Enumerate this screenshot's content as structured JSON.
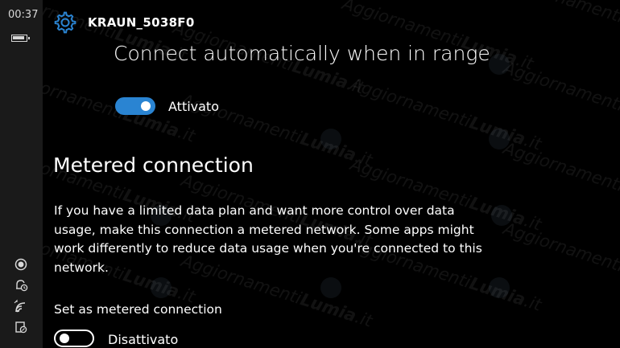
{
  "status_bar": {
    "time": "00:37",
    "icons": [
      "battery-icon",
      "location-icon",
      "quiet-hours-icon",
      "wifi-icon",
      "notification-icon"
    ]
  },
  "header": {
    "icon": "gear-icon",
    "network_name": "KRAUN_5038F0"
  },
  "connect_auto": {
    "label": "Connect automatically when in range",
    "toggle_on": true,
    "state_label": "Attivato"
  },
  "metered": {
    "title": "Metered connection",
    "description": "If you have a limited data plan and want more control over data usage, make this connection a metered network. Some apps might work differently to reduce data usage when you're connected to this network.",
    "set_label": "Set as metered connection",
    "toggle_on": false,
    "state_label": "Disattivato"
  },
  "watermark": {
    "text_main": "Aggiornamenti",
    "text_bold": "Lumia",
    "text_suffix": ".it"
  },
  "colors": {
    "accent": "#2a84d2",
    "background": "#000000",
    "status_bar": "#1a1a1a"
  }
}
